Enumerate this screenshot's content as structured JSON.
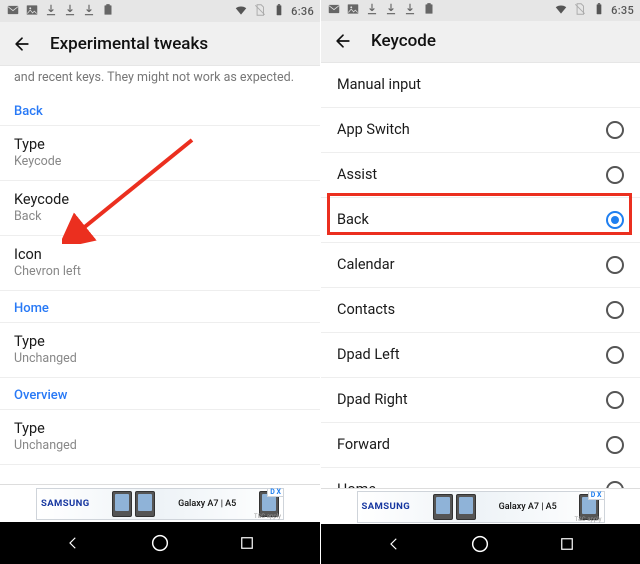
{
  "left": {
    "status_time": "6:36",
    "toolbar_title": "Experimental tweaks",
    "partial_desc": "and recent keys. They might not work as expected.",
    "sections": {
      "back": {
        "label": "Back",
        "type_title": "Type",
        "type_value": "Keycode",
        "keycode_title": "Keycode",
        "keycode_value": "Back",
        "icon_title": "Icon",
        "icon_value": "Chevron left"
      },
      "home": {
        "label": "Home",
        "type_title": "Type",
        "type_value": "Unchanged"
      },
      "overview": {
        "label": "Overview",
        "type_title": "Type",
        "type_value": "Unchanged"
      }
    }
  },
  "right": {
    "status_time": "6:35",
    "toolbar_title": "Keycode",
    "selected": "Back",
    "options": [
      "Manual input",
      "App Switch",
      "Assist",
      "Back",
      "Calendar",
      "Contacts",
      "Dpad Left",
      "Dpad Right",
      "Forward",
      "Home"
    ]
  },
  "ad": {
    "brand": "SAMSUNG",
    "product": "Galaxy A7 | A5",
    "badge": "D X",
    "tac": "T&C apply"
  }
}
